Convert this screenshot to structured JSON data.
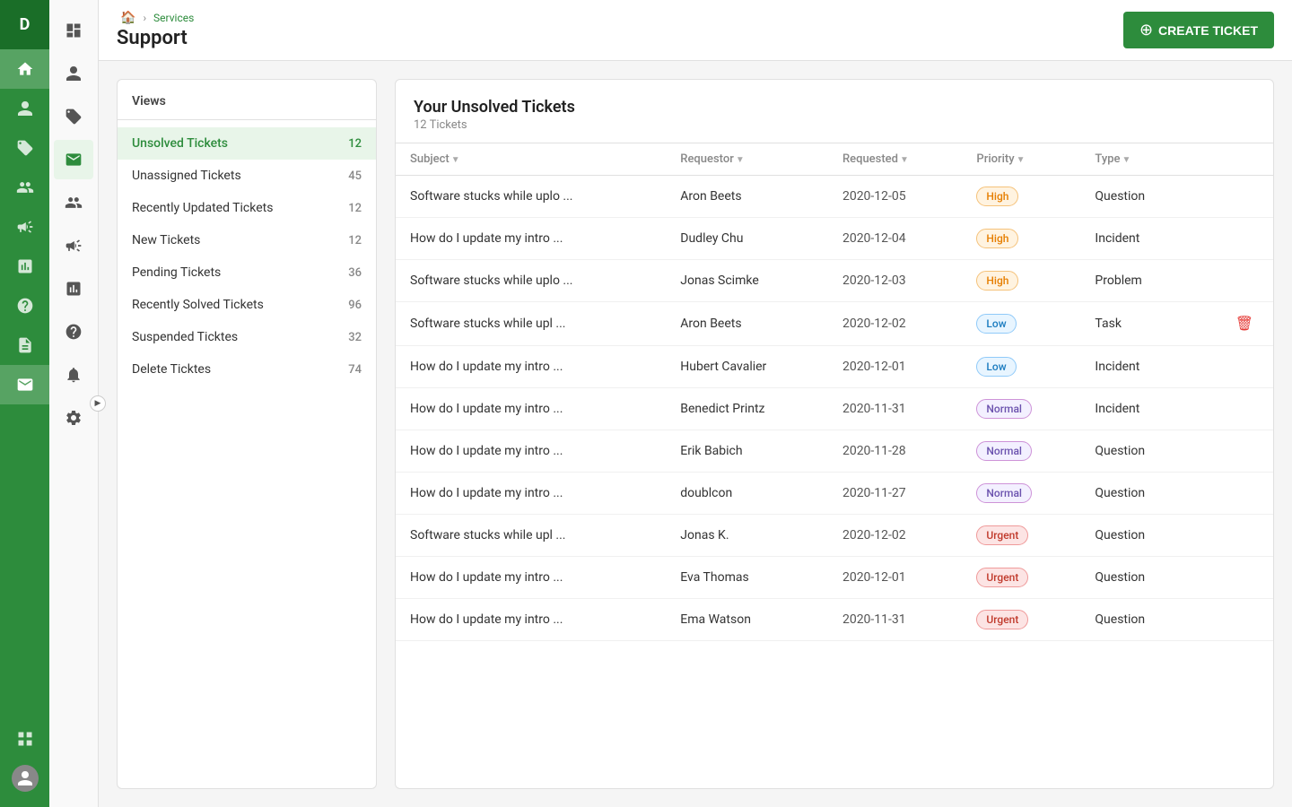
{
  "app": {
    "logo": "D"
  },
  "breadcrumb": {
    "home_icon": "🏠",
    "separator": "›",
    "parent": "Services",
    "current": "Support"
  },
  "header": {
    "title": "Support",
    "create_button": "CREATE TICKET",
    "create_icon": "+"
  },
  "sidebar": {
    "title": "Views",
    "items": [
      {
        "label": "Unsolved Tickets",
        "count": "12",
        "active": true
      },
      {
        "label": "Unassigned Tickets",
        "count": "45",
        "active": false
      },
      {
        "label": "Recently Updated Tickets",
        "count": "12",
        "active": false
      },
      {
        "label": "New Tickets",
        "count": "12",
        "active": false
      },
      {
        "label": "Pending Tickets",
        "count": "36",
        "active": false
      },
      {
        "label": "Recently Solved Tickets",
        "count": "96",
        "active": false
      },
      {
        "label": "Suspended Ticktes",
        "count": "32",
        "active": false
      },
      {
        "label": "Delete Ticktes",
        "count": "74",
        "active": false
      }
    ]
  },
  "table": {
    "title": "Your Unsolved Tickets",
    "subtitle": "12 Tickets",
    "columns": [
      {
        "key": "subject",
        "label": "Subject",
        "sortable": true
      },
      {
        "key": "requestor",
        "label": "Requestor",
        "sortable": true
      },
      {
        "key": "requested",
        "label": "Requested",
        "sortable": true
      },
      {
        "key": "priority",
        "label": "Priority",
        "sortable": true
      },
      {
        "key": "type",
        "label": "Type",
        "sortable": true
      }
    ],
    "rows": [
      {
        "subject": "Software stucks while uplo ...",
        "requestor": "Aron Beets",
        "requested": "2020-12-05",
        "priority": "High",
        "priority_class": "high",
        "type": "Question",
        "has_delete": false
      },
      {
        "subject": "How  do I update my intro  ...",
        "requestor": "Dudley Chu",
        "requested": "2020-12-04",
        "priority": "High",
        "priority_class": "high",
        "type": "Incident",
        "has_delete": false
      },
      {
        "subject": "Software stucks while uplo ...",
        "requestor": "Jonas Scimke",
        "requested": "2020-12-03",
        "priority": "High",
        "priority_class": "high",
        "type": "Problem",
        "has_delete": false
      },
      {
        "subject": "Software stucks while upl ...",
        "requestor": "Aron Beets",
        "requested": "2020-12-02",
        "priority": "Low",
        "priority_class": "low",
        "type": "Task",
        "has_delete": true
      },
      {
        "subject": "How  do I update my intro  ...",
        "requestor": "Hubert Cavalier",
        "requested": "2020-12-01",
        "priority": "Low",
        "priority_class": "low",
        "type": "Incident",
        "has_delete": false
      },
      {
        "subject": "How  do I update my intro  ...",
        "requestor": "Benedict Printz",
        "requested": "2020-11-31",
        "priority": "Normal",
        "priority_class": "normal",
        "type": "Incident",
        "has_delete": false
      },
      {
        "subject": "How  do I update my intro  ...",
        "requestor": "Erik Babich",
        "requested": "2020-11-28",
        "priority": "Normal",
        "priority_class": "normal",
        "type": "Question",
        "has_delete": false
      },
      {
        "subject": "How  do I update my intro  ...",
        "requestor": "doublcon",
        "requested": "2020-11-27",
        "priority": "Normal",
        "priority_class": "normal",
        "type": "Question",
        "has_delete": false
      },
      {
        "subject": "Software stucks while upl ...",
        "requestor": "Jonas K.",
        "requested": "2020-12-02",
        "priority": "Urgent",
        "priority_class": "urgent",
        "type": "Question",
        "has_delete": false
      },
      {
        "subject": "How  do I update my intro  ...",
        "requestor": "Eva Thomas",
        "requested": "2020-12-01",
        "priority": "Urgent",
        "priority_class": "urgent",
        "type": "Question",
        "has_delete": false
      },
      {
        "subject": "How  do I update my intro ...",
        "requestor": "Ema Watson",
        "requested": "2020-11-31",
        "priority": "Urgent",
        "priority_class": "urgent",
        "type": "Question",
        "has_delete": false
      }
    ]
  },
  "nav": {
    "far_icons": [
      "🏠",
      "👤",
      "🏷",
      "👥",
      "📢",
      "📋",
      "❓",
      "📄",
      "📥",
      "⚙"
    ],
    "second_icons": [
      "📊",
      "📊",
      "📊",
      "📊",
      "📊",
      "📊",
      "📊"
    ]
  }
}
